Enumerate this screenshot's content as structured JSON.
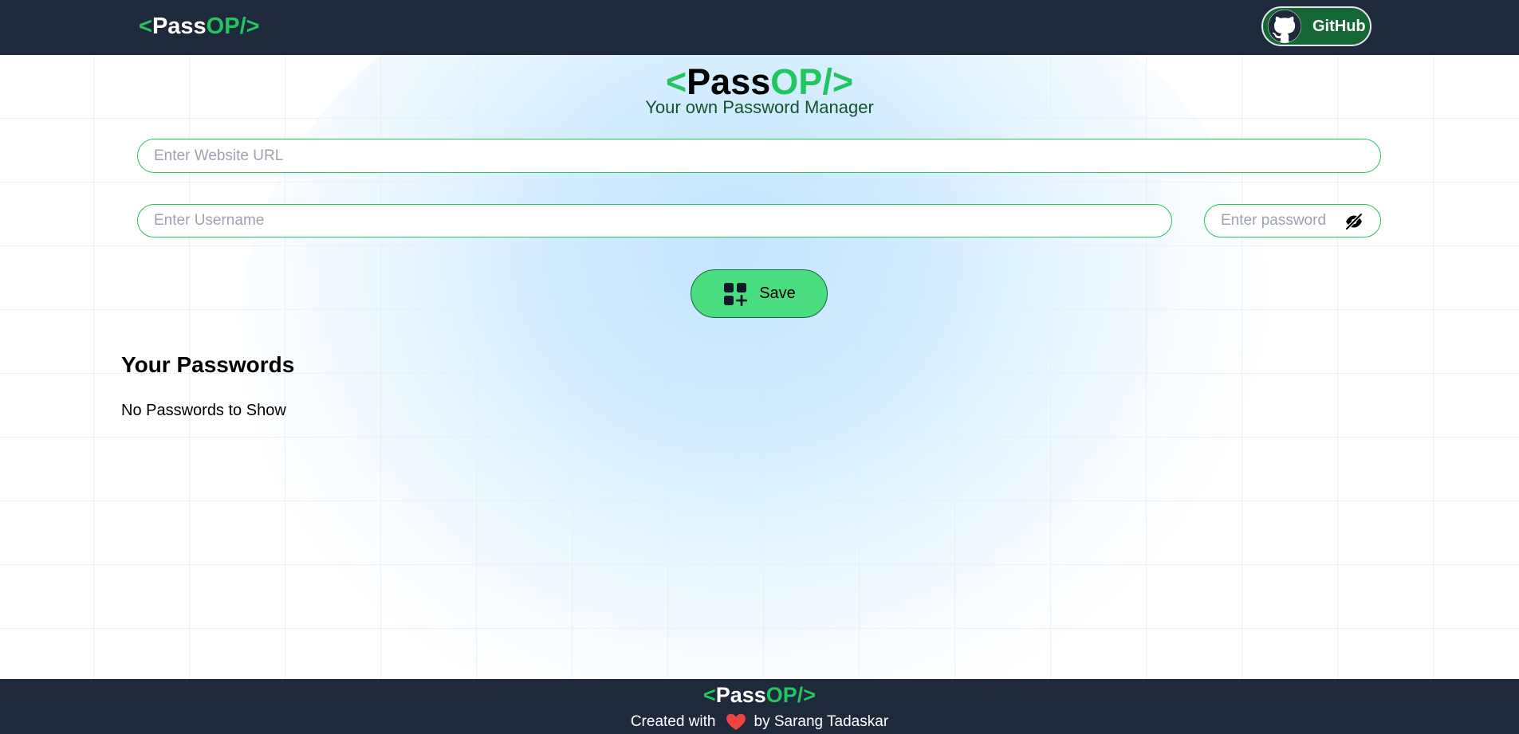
{
  "brand": {
    "open": "<",
    "pass": "Pass",
    "op": "OP",
    "close": "/>"
  },
  "navbar": {
    "github_label": "GitHub",
    "github_icon": "github-icon"
  },
  "hero": {
    "tagline": "Your own Password Manager"
  },
  "form": {
    "url_placeholder": "Enter Website URL",
    "url_value": "",
    "username_placeholder": "Enter Username",
    "username_value": "",
    "password_placeholder": "Enter password",
    "password_value": "",
    "password_toggle_icon": "eye-slash-icon",
    "save_label": "Save",
    "save_icon": "add-grid-icon"
  },
  "passwords": {
    "title": "Your Passwords",
    "empty_text": "No Passwords to Show"
  },
  "footer": {
    "credit_prefix": "Created with",
    "heart_icon": "heart-icon",
    "credit_suffix": "by Sarang Tadaskar"
  },
  "colors": {
    "nav_bg": "#1e293b",
    "accent_green": "#22c55e",
    "button_green": "#4ade80",
    "github_bg": "#166534",
    "heart": "#ef4444"
  }
}
